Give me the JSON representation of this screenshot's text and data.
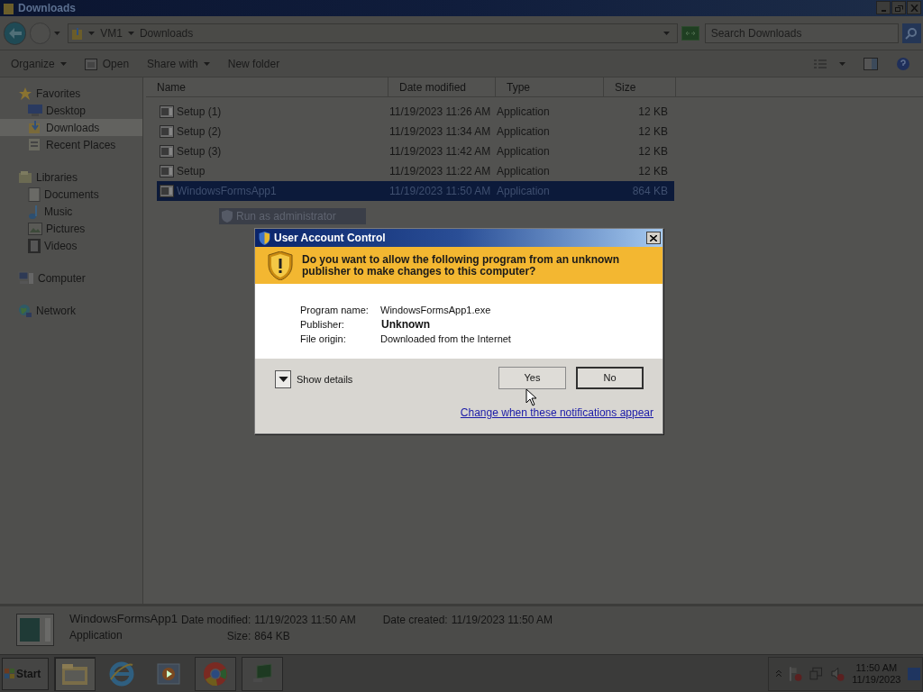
{
  "window": {
    "title": "Downloads"
  },
  "address": {
    "crumbs": [
      "VM1",
      "Downloads"
    ],
    "search_placeholder": "Search Downloads"
  },
  "toolbar": [
    {
      "label": "Organize",
      "kind": "menu"
    },
    {
      "label": "Open",
      "kind": "icon"
    },
    {
      "label": "Share with",
      "kind": "menu"
    },
    {
      "label": "New folder",
      "kind": "plain"
    }
  ],
  "sidebar": [
    {
      "label": "Favorites",
      "children": [
        {
          "label": "Desktop",
          "selected": false
        },
        {
          "label": "Downloads",
          "selected": true
        },
        {
          "label": "Recent Places",
          "selected": false
        }
      ]
    },
    {
      "label": "Libraries",
      "children": [
        {
          "label": "Documents",
          "selected": false
        },
        {
          "label": "Music",
          "selected": false
        },
        {
          "label": "Pictures",
          "selected": false
        },
        {
          "label": "Videos",
          "selected": false
        }
      ]
    },
    {
      "label": "Computer"
    },
    {
      "label": "Network"
    }
  ],
  "table": {
    "columns": [
      "Name",
      "Date modified",
      "Type",
      "Size"
    ],
    "rows": [
      {
        "name": "Setup (1)",
        "date": "11/19/2023 11:26 AM",
        "type": "Application",
        "size": "12 KB",
        "selected": false
      },
      {
        "name": "Setup (2)",
        "date": "11/19/2023 11:34 AM",
        "type": "Application",
        "size": "12 KB",
        "selected": false
      },
      {
        "name": "Setup (3)",
        "date": "11/19/2023 11:42 AM",
        "type": "Application",
        "size": "12 KB",
        "selected": false
      },
      {
        "name": "Setup",
        "date": "11/19/2023 11:22 AM",
        "type": "Application",
        "size": "12 KB",
        "selected": false
      },
      {
        "name": "WindowsFormsApp1",
        "date": "11/19/2023 11:50 AM",
        "type": "Application",
        "size": "864 KB",
        "selected": true
      }
    ]
  },
  "context_item": "Run as administrator",
  "dialog": {
    "title": "User Account Control",
    "question": "Do you want to allow the following program from an unknown publisher to make changes to this computer?",
    "fields": [
      {
        "label": "Program name:",
        "value": "WindowsFormsApp1.exe",
        "emphasis": false
      },
      {
        "label": "Publisher:",
        "value": "Unknown",
        "emphasis": true
      },
      {
        "label": "File origin:",
        "value": "Downloaded from the Internet",
        "emphasis": false
      }
    ],
    "details_toggle": "Show details",
    "buttons": [
      {
        "label": "Yes",
        "default": false
      },
      {
        "label": "No",
        "default": true
      }
    ],
    "link": "Change when these notifications appear"
  },
  "details_pane": {
    "name": "WindowsFormsApp1",
    "kind": "Application",
    "properties": [
      {
        "label": "Date modified:",
        "value": "11/19/2023 11:50 AM"
      },
      {
        "label": "Date created:",
        "value": "11/19/2023 11:50 AM"
      },
      {
        "label": "Size:",
        "value": "864 KB"
      }
    ]
  },
  "taskbar": {
    "start": "Start",
    "apps": [
      {
        "running": true,
        "active": true
      },
      {
        "running": false,
        "active": false
      },
      {
        "running": false,
        "active": false
      },
      {
        "running": true,
        "active": false
      },
      {
        "running": true,
        "active": false
      }
    ],
    "time": "11:50 AM",
    "date": "11/19/2023"
  }
}
